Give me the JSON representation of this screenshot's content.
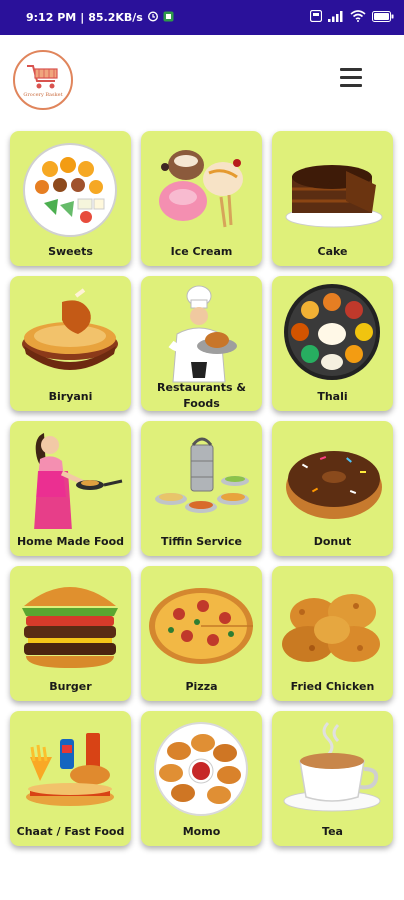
{
  "status_bar": {
    "time": "9:12 PM",
    "speed": "85.2KB/s",
    "icons": [
      "alarm-icon",
      "app-notification-icon",
      "vowifi-icon",
      "signal-icon",
      "wifi-icon",
      "battery-icon"
    ]
  },
  "app_bar": {
    "logo_icon": "shopping-cart-logo",
    "logo_text": "Grocery Basket",
    "menu_icon": "hamburger-menu-icon"
  },
  "categories": [
    {
      "label": "Sweets",
      "icon": "sweets-platter"
    },
    {
      "label": "Ice Cream",
      "icon": "ice-cream-scoops"
    },
    {
      "label": "Cake",
      "icon": "chocolate-cake"
    },
    {
      "label": "Biryani",
      "icon": "biryani-bowl"
    },
    {
      "label": "Restaurants & Foods",
      "icon": "chef"
    },
    {
      "label": "Thali",
      "icon": "thali-plate"
    },
    {
      "label": "Home Made Food",
      "icon": "woman-cooking"
    },
    {
      "label": "Tiffin Service",
      "icon": "tiffin-box"
    },
    {
      "label": "Donut",
      "icon": "donut"
    },
    {
      "label": "Burger",
      "icon": "burger"
    },
    {
      "label": "Pizza",
      "icon": "pizza"
    },
    {
      "label": "Fried Chicken",
      "icon": "fried-chicken"
    },
    {
      "label": "Chaat / Fast Food",
      "icon": "fast-food"
    },
    {
      "label": "Momo",
      "icon": "momo-plate"
    },
    {
      "label": "Tea",
      "icon": "tea-cup"
    }
  ],
  "colors": {
    "status_bar": "#2a119a",
    "card_background": "#dff07a",
    "logo_accent": "#e0855c"
  }
}
